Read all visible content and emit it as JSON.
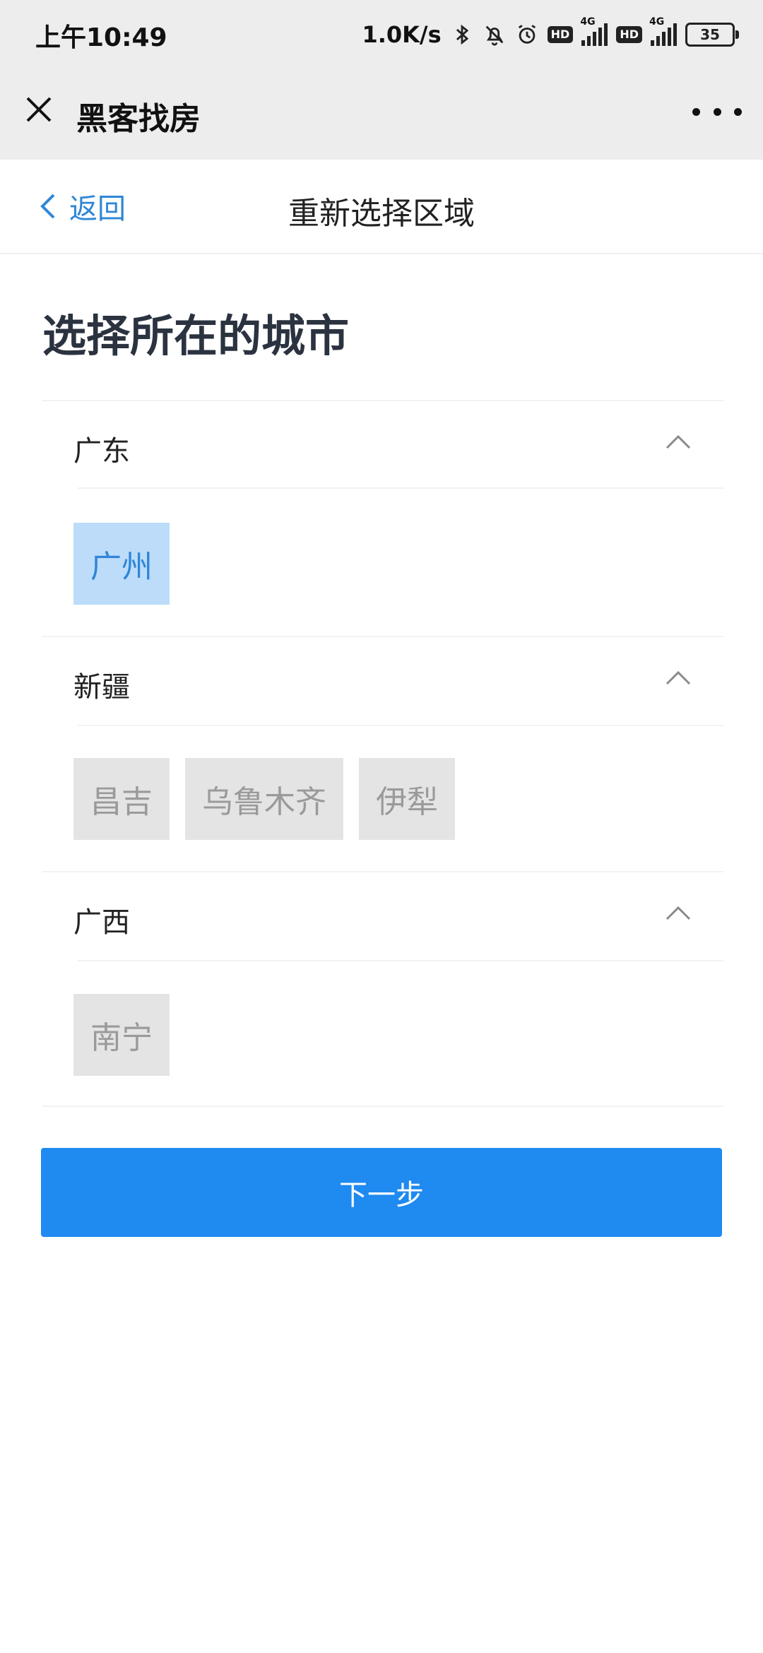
{
  "status_bar": {
    "time": "上午10:49",
    "net_speed": "1.0K/s",
    "hd_label": "HD",
    "network_label": "4G",
    "battery": "35"
  },
  "mini_program": {
    "title": "黑客找房"
  },
  "nav": {
    "back_label": "返回",
    "title": "重新选择区域"
  },
  "page": {
    "heading": "选择所在的城市"
  },
  "provinces": [
    {
      "name": "广东",
      "expanded": true,
      "cities": [
        {
          "name": "广州",
          "selected": true
        }
      ]
    },
    {
      "name": "新疆",
      "expanded": true,
      "cities": [
        {
          "name": "昌吉",
          "selected": false
        },
        {
          "name": "乌鲁木齐",
          "selected": false
        },
        {
          "name": "伊犁",
          "selected": false
        }
      ]
    },
    {
      "name": "广西",
      "expanded": true,
      "cities": [
        {
          "name": "南宁",
          "selected": false
        }
      ]
    }
  ],
  "actions": {
    "next_label": "下一步"
  },
  "colors": {
    "accent": "#1f8af0",
    "link": "#2f86d6",
    "selected_bg": "#bcdcfa",
    "unselected_bg": "#e4e4e4",
    "header_bg": "#ededed"
  }
}
